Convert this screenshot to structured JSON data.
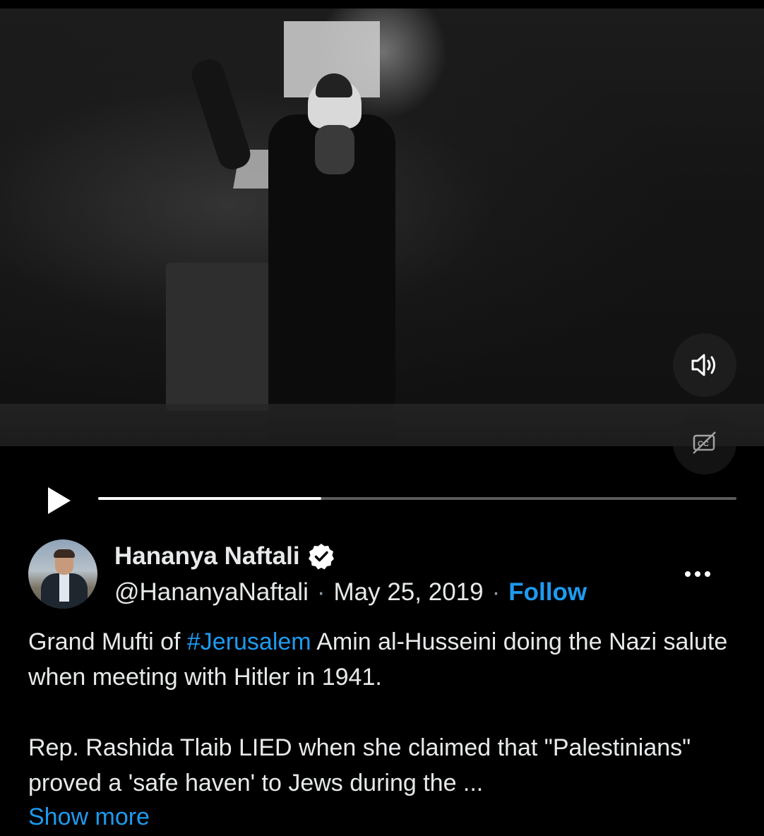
{
  "video": {
    "progress_fraction": 0.35
  },
  "author": {
    "name": "Hananya Naftali",
    "handle": "@HananyaNaftali",
    "date": "May 25, 2019",
    "separator": "·",
    "follow_label": "Follow"
  },
  "tweet": {
    "line1_pre": "Grand Mufti of ",
    "hashtag": "#Jerusalem",
    "line1_post": " Amin al-Husseini doing the Nazi salute when meeting with Hitler in 1941.",
    "paragraph2": "Rep. Rashida Tlaib LIED when she claimed that \"Palestinians\" proved a 'safe haven' to Jews during the ...",
    "show_more": "Show more"
  },
  "colors": {
    "accent": "#1d9bf0",
    "background": "#000000",
    "text": "#e7e9ea"
  },
  "icons": [
    "volume-icon",
    "closed-captions-icon",
    "play-icon",
    "verified-badge-icon",
    "more-options-icon"
  ]
}
